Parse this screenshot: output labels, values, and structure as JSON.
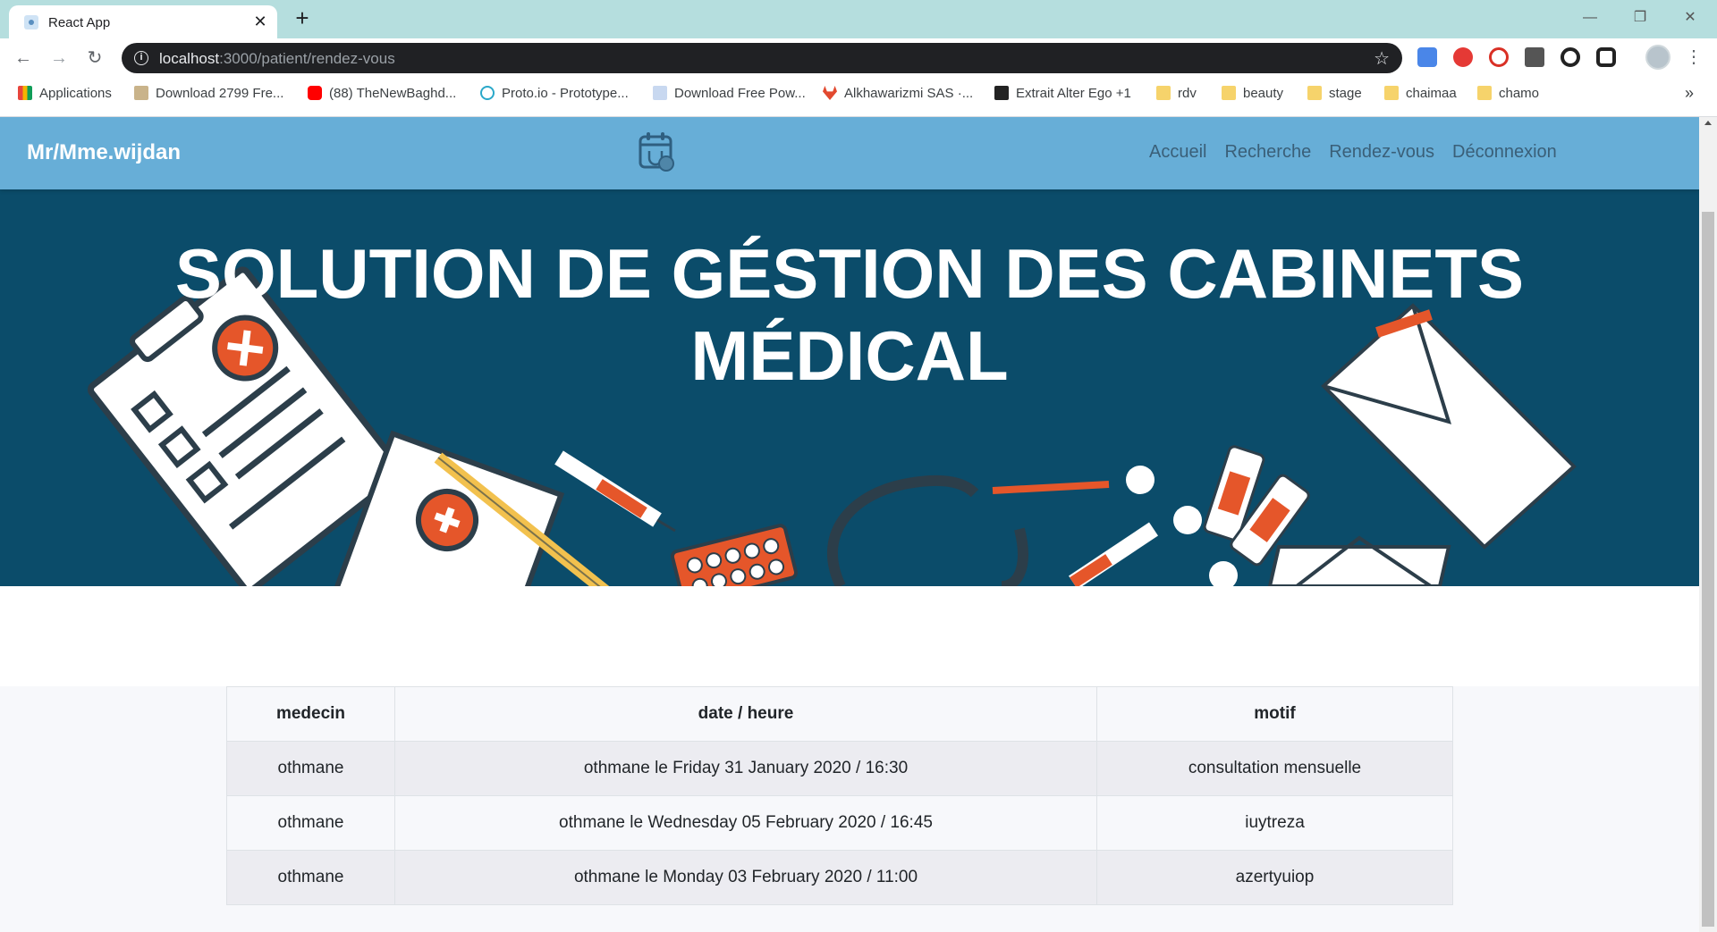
{
  "browser": {
    "tab_title": "React App",
    "url_host": "localhost",
    "url_rest": ":3000/patient/rendez-vous",
    "bookmarks": [
      {
        "label": "Applications",
        "color": "#e8453c"
      },
      {
        "label": "Download 2799 Fre...",
        "color": "#c9b38a"
      },
      {
        "label": "(88) TheNewBaghd...",
        "color": "#ff0000"
      },
      {
        "label": "Proto.io - Prototype...",
        "color": "#2aa8c9"
      },
      {
        "label": "Download Free Pow...",
        "color": "#c8d8f0"
      },
      {
        "label": "Alkhawarizmi SAS ·...",
        "color": "#e2492f"
      },
      {
        "label": "Extrait Alter Ego +1",
        "color": "#222222"
      },
      {
        "label": "rdv",
        "color": "#f6d36b"
      },
      {
        "label": "beauty",
        "color": "#f6d36b"
      },
      {
        "label": "stage",
        "color": "#f6d36b"
      },
      {
        "label": "chaimaa",
        "color": "#f6d36b"
      },
      {
        "label": "chamo",
        "color": "#f6d36b"
      }
    ]
  },
  "app": {
    "brand": "Mr/Mme.wijdan",
    "nav": [
      "Accueil",
      "Recherche",
      "Rendez-vous",
      "Déconnexion"
    ],
    "hero_line1": "SOLUTION DE GÉSTION DES CABINETS",
    "hero_line2": "MÉDICAL",
    "colors": {
      "navbar": "#67aed7",
      "hero": "#0b4c6a",
      "accent": "#e5562a"
    }
  },
  "table": {
    "headers": [
      "medecin",
      "date / heure",
      "motif"
    ],
    "rows": [
      [
        "othmane",
        "othmane le Friday 31 January 2020 / 16:30",
        "consultation mensuelle"
      ],
      [
        "othmane",
        "othmane le Wednesday 05 February 2020 / 16:45",
        "iuytreza"
      ],
      [
        "othmane",
        "othmane le Monday 03 February 2020 / 11:00",
        "azertyuiop"
      ]
    ]
  }
}
